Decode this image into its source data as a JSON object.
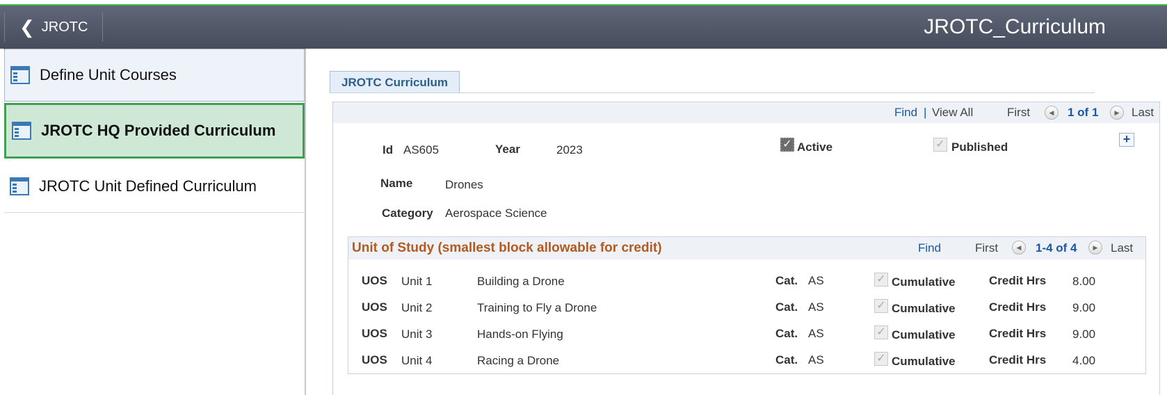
{
  "header": {
    "back_label": "JROTC",
    "title": "JROTC_Curriculum"
  },
  "sidebar": {
    "items": [
      {
        "label": "Define Unit Courses"
      },
      {
        "label": "JROTC HQ Provided Curriculum"
      },
      {
        "label": "JROTC Unit Defined Curriculum"
      }
    ]
  },
  "tab": {
    "label": "JROTC Curriculum"
  },
  "main_nav": {
    "find": "Find",
    "sep": "|",
    "view_all": "View All",
    "first": "First",
    "count": "1 of 1",
    "last": "Last"
  },
  "record": {
    "id_label": "Id",
    "id_value": "AS605",
    "year_label": "Year",
    "year_value": "2023",
    "active_label": "Active",
    "published_label": "Published",
    "name_label": "Name",
    "name_value": "Drones",
    "category_label": "Category",
    "category_value": "Aerospace Science"
  },
  "uos": {
    "title": "Unit of Study (smallest block allowable for credit)",
    "find": "Find",
    "first": "First",
    "count": "1-4 of 4",
    "last": "Last",
    "uos_label": "UOS",
    "cat_label": "Cat.",
    "cumulative_label": "Cumulative",
    "credit_label": "Credit Hrs",
    "rows": [
      {
        "unit": "Unit 1",
        "desc": "Building a Drone",
        "cat": "AS",
        "hrs": "8.00"
      },
      {
        "unit": "Unit 2",
        "desc": "Training to Fly a Drone",
        "cat": "AS",
        "hrs": "9.00"
      },
      {
        "unit": "Unit 3",
        "desc": "Hands-on Flying",
        "cat": "AS",
        "hrs": "9.00"
      },
      {
        "unit": "Unit 4",
        "desc": "Racing a Drone",
        "cat": "AS",
        "hrs": "4.00"
      }
    ]
  },
  "colors": {
    "header": "#4f5666",
    "accent_green": "#3fb94a",
    "selected_nav": "#cfe8d6",
    "link_blue": "#1a57a5",
    "section_title": "#b35a1f"
  }
}
